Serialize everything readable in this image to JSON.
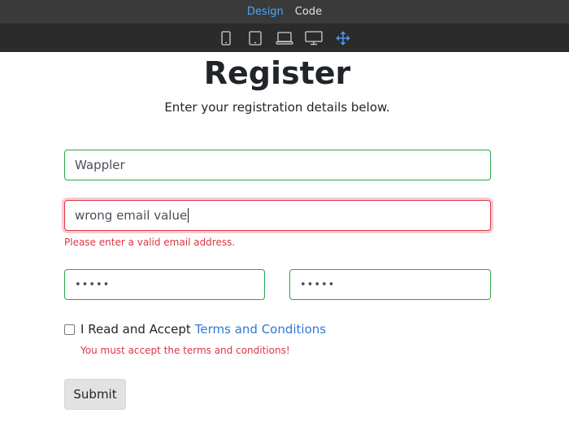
{
  "tabs": [
    {
      "label": "Design",
      "active": true
    },
    {
      "label": "Code",
      "active": false
    }
  ],
  "devices": [
    "phone-icon",
    "tablet-icon",
    "laptop-icon",
    "desktop-icon",
    "fluid-move-icon"
  ],
  "colors": {
    "accent": "#4da3ff",
    "valid": "#28a745",
    "invalid": "#dc3545",
    "link": "#2f78d7"
  },
  "form": {
    "title": "Register",
    "subtitle": "Enter your registration details below.",
    "name_value": "Wappler",
    "email_value": "wrong email value",
    "email_error": "Please enter a valid email address.",
    "password_value": "•••••",
    "confirm_password_value": "•••••",
    "terms_label": "I Read and Accept",
    "terms_link": "Terms and Conditions",
    "terms_error": "You must accept the terms and conditions!",
    "submit_label": "Submit"
  }
}
